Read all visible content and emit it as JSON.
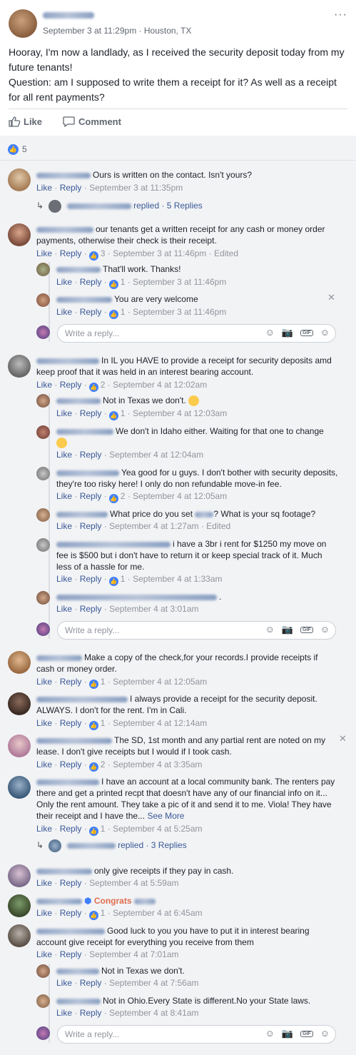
{
  "post": {
    "meta": "September 3 at 11:29pm · Houston, TX",
    "more": "···",
    "text_line1": "Hooray, I'm now a landlady, as I received the security deposit today from my future tenants!",
    "text_line2": "Question: am I supposed to write them a receipt for it? As well as a receipt for all rent payments?",
    "like_label": "Like",
    "comment_label": "Comment",
    "reactions_count": "5"
  },
  "ui": {
    "like": "Like",
    "reply": "Reply",
    "dot": "·",
    "reply_placeholder": "Write a reply...",
    "close": "✕",
    "see_more": "See More"
  },
  "comments": [
    {
      "text": "Ours is written on the contact. Isn't yours?",
      "ts": "September 3 at 11:35pm",
      "replies": "replied · 5 Replies"
    },
    {
      "text": "our tenants get a written receipt for any cash or money order payments, otherwise their check is their receipt.",
      "likes": "3",
      "ts": "September 3 at 11:46pm · Edited"
    },
    {
      "text": "That'll work. Thanks!",
      "likes": "1",
      "ts": "September 3 at 11:46pm"
    },
    {
      "text": "You are very welcome",
      "likes": "1",
      "ts": "September 3 at 11:46pm"
    },
    {
      "text": "In IL you HAVE to provide a receipt for security deposits amd keep proof that it was held in an interest bearing account.",
      "likes": "2",
      "ts": "September 4 at 12:02am"
    },
    {
      "text": "Not in Texas we don't.",
      "likes": "1",
      "ts": "September 4 at 12:03am"
    },
    {
      "text": "We don't in Idaho either. Waiting for that one to change",
      "ts": "September 4 at 12:04am"
    },
    {
      "text": "Yea good for u guys. I don't bother with security deposits, they're too risky here! I only do non refundable move-in fee.",
      "likes": "2",
      "ts": "September 4 at 12:05am"
    },
    {
      "text": "What price do you set",
      "text2": "? What is your sq footage?",
      "ts": "September 4 at 1:27am · Edited"
    },
    {
      "text": "i have a 3br i rent for $1250 my move on fee is $500 but i don't have to return it or keep special track of it. Much less of a hassle for me.",
      "likes": "1",
      "ts": "September 4 at 1:33am"
    },
    {
      "text": ".",
      "ts": "September 4 at 3:01am"
    },
    {
      "text": "Make a copy of the check,for your records.I provide receipts if cash or money order.",
      "likes": "1",
      "ts": "September 4 at 12:05am"
    },
    {
      "text": "I always provide a receipt for the security deposit. ALWAYS. I don't for the rent. I'm in Cali.",
      "likes": "1",
      "ts": "September 4 at 12:14am"
    },
    {
      "text": "The SD, 1st month and any partial rent are noted on my lease. I don't give receipts but I would if I took cash.",
      "likes": "2",
      "ts": "September 4 at 3:35am"
    },
    {
      "text": "I have an account at a local community bank. The renters pay there and get a printed recpt that doesn't have any of our financial info on it... Only the rent amount. They take a pic of it and send it to me. Viola! They have their receipt and I have the...",
      "likes": "1",
      "ts": "September 4 at 5:25am",
      "replies": "replied · 3 Replies"
    },
    {
      "text": "only give receipts if they pay in cash.",
      "ts": "September 4 at 5:59am"
    },
    {
      "text": "Congrats",
      "likes": "1",
      "ts": "September 4 at 6:45am"
    },
    {
      "text": "Good luck to you you have to put it in interest bearing account give receipt for everything you receive from them",
      "ts": "September 4 at 7:01am"
    },
    {
      "text": "Not in Texas we don't.",
      "ts": "September 4 at 7:56am"
    },
    {
      "text": "Not in Ohio.Every State is different.No your State laws.",
      "ts": "September 4 at 8:41am"
    }
  ],
  "colors": {
    "link": "#385898",
    "like_blue": "#4080ff",
    "background": "#f2f3f5"
  }
}
